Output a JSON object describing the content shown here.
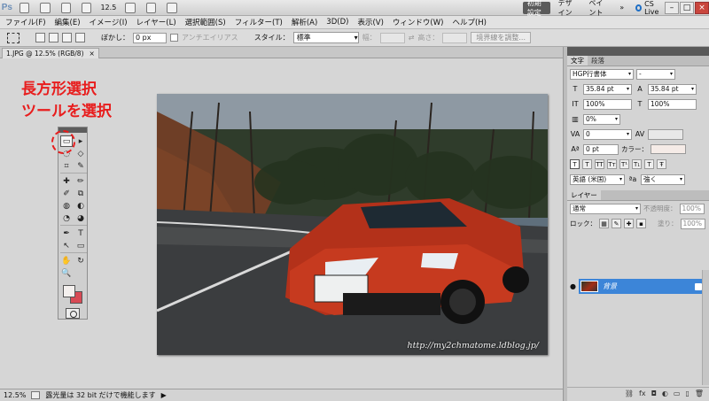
{
  "app": {
    "logo": "Ps",
    "zoom": "12.5"
  },
  "workspaces": {
    "essentials": "初期設定",
    "design": "デザイン",
    "paint": "ペイント",
    "more": "»",
    "cslive": "CS Live"
  },
  "window_controls": {
    "minimize": "–",
    "restore": "□",
    "close": "×"
  },
  "menu": [
    "ファイル(F)",
    "編集(E)",
    "イメージ(I)",
    "レイヤー(L)",
    "選択範囲(S)",
    "フィルター(T)",
    "解析(A)",
    "3D(D)",
    "表示(V)",
    "ウィンドウ(W)",
    "ヘルプ(H)"
  ],
  "options": {
    "feather_label": "ぼかし：",
    "feather_value": "0 px",
    "antialias_label": "アンチエイリアス",
    "style_label": "スタイル：",
    "style_value": "標準",
    "width_label": "幅：",
    "height_label": "高さ：",
    "refine_label": "境界線を調整..."
  },
  "document": {
    "tab_title": "1.JPG @ 12.5% (RGB/8)",
    "tab_close": "×",
    "watermark": "http://my2chmatome.ldblog.jp/"
  },
  "annotation": {
    "line1": "長方形選択",
    "line2": "ツールを選択"
  },
  "status": {
    "zoom": "12.5%",
    "info": "露光量は 32 bit だけで機能します",
    "arrow": "▶"
  },
  "character_panel": {
    "tabs": [
      "文字",
      "段落"
    ],
    "font_family": "HGP行書体",
    "font_style": "-",
    "font_size": "35.84 pt",
    "leading": "35.84 pt",
    "vertical_scale": "100%",
    "horizontal_scale": "100%",
    "tsume": "0%",
    "tracking": "0",
    "baseline_shift": "0 pt",
    "color_label": "カラー：",
    "formats": [
      "T",
      "T",
      "TT",
      "Tт",
      "T¹",
      "T₁",
      "T",
      "Ŧ"
    ],
    "language": "英語 (米国)",
    "aa_icon": "ªa",
    "antialias": "強く"
  },
  "layers_panel": {
    "tab": "レイヤー",
    "blend_mode": "通常",
    "opacity_label": "不透明度：",
    "opacity_value": "100%",
    "lock_label": "ロック：",
    "fill_label": "塗り：",
    "fill_value": "100%",
    "layer_name": "背景",
    "bottom_icons": [
      "⛓",
      "fx",
      "◘",
      "◐",
      "▭",
      "▯",
      "🗑"
    ]
  },
  "tools": {
    "icons": [
      "▭",
      "▸",
      "◌",
      "◇",
      "⌗",
      "✎",
      "✚",
      "✏",
      "✐",
      "⧉",
      "◍",
      "◐",
      "◔",
      "◕",
      "✒",
      "T",
      "↖",
      "▭",
      "✋",
      "↻",
      "🔍",
      ""
    ]
  }
}
